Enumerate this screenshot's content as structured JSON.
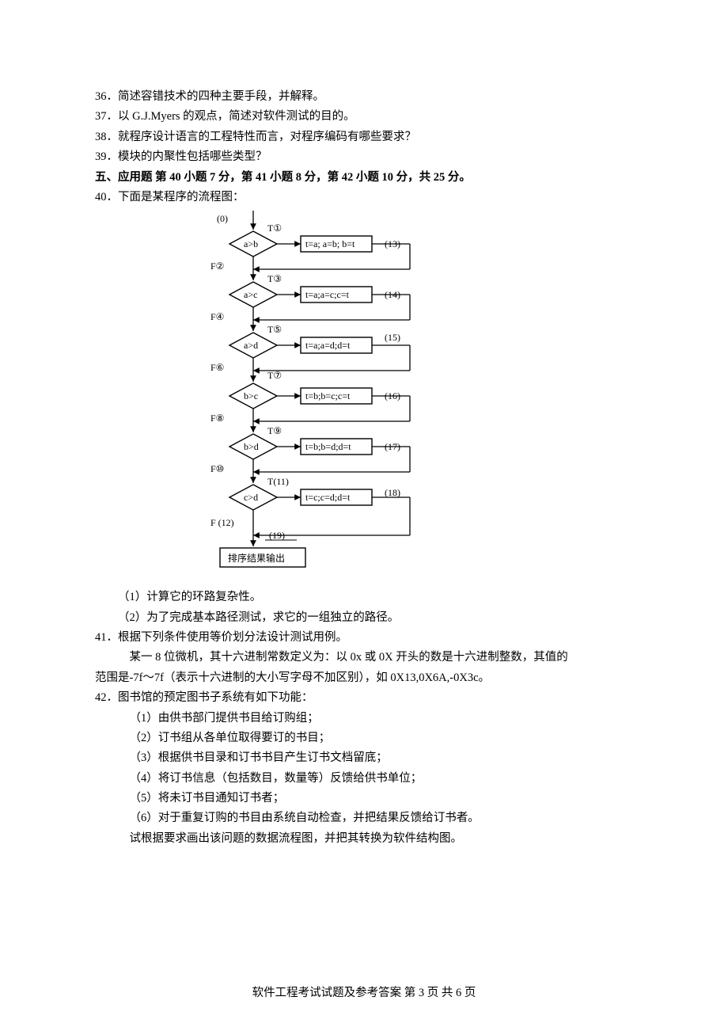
{
  "questions": {
    "q36": "36．简述容错技术的四种主要手段，并解释。",
    "q37": "37．以 G.J.Myers 的观点，简述对软件测试的目的。",
    "q38": "38．就程序设计语言的工程特性而言，对程序编码有哪些要求？",
    "q39": "39．模块的内聚性包括哪些类型？",
    "section5": "五、应用题 第 40 小题 7 分，第 41 小题 8 分，第 42 小题 10 分，共 25 分。",
    "q40intro": "40．下面是某程序的流程图：",
    "q40_1": "（1）计算它的环路复杂性。",
    "q40_2": "（2）为了完成基本路径测试，求它的一组独立的路径。",
    "q41intro": "41．根据下列条件使用等价划分法设计测试用例。",
    "q41_body1": "某一 8 位微机，其十六进制常数定义为：以 0x 或 0X 开头的数是十六进制整数，其值的",
    "q41_body2": "范围是-7f～7f（表示十六进制的大小写字母不加区别），如 0X13,0X6A,-0X3c。",
    "q42intro": "42．图书馆的预定图书子系统有如下功能：",
    "q42_1": "（1）由供书部门提供书目给订购组；",
    "q42_2": "（2）订书组从各单位取得要订的书目；",
    "q42_3": "（3）根据供书目录和订书书目产生订书文档留底；",
    "q42_4": "（4）将订书信息（包括数目，数量等）反馈给供书单位；",
    "q42_5": "（5）将未订书目通知订书者；",
    "q42_6": "（6）对于重复订购的书目由系统自动检查，并把结果反馈给订书者。",
    "q42_end": "试根据要求画出该问题的数据流程图，并把其转换为软件结构图。"
  },
  "flow": {
    "start": "(0)",
    "d1": "a>b",
    "t1": "T①",
    "f1": "F②",
    "r1": "t=a; a=b; b=t",
    "e1": "(13)",
    "d3": "a>c",
    "t3": "T③",
    "f3": "F④",
    "r3": "t=a;a=c;c=t",
    "e3": "(14)",
    "d5": "a>d",
    "t5": "T⑤",
    "f5": "F⑥",
    "r5": "t=a;a=d;d=t",
    "e5": "(15)",
    "d7": "b>c",
    "t7": "T⑦",
    "f7": "F⑧",
    "r7": "t=b;b=c;c=t",
    "e7": "(16)",
    "d9": "b>d",
    "t9": "T⑨",
    "f9": "F⑩",
    "r9": "t=b;b=d;d=t",
    "e9": "(17)",
    "d11": "c>d",
    "t11": "T(11)",
    "f11": "F (12)",
    "r11": "t=c;c=d;d=t",
    "e11": "(18)",
    "merge19": "(19)",
    "out": "排序结果输出"
  },
  "footer": {
    "text": "软件工程考试试题及参考答案   第 3 页 共 6 页"
  }
}
